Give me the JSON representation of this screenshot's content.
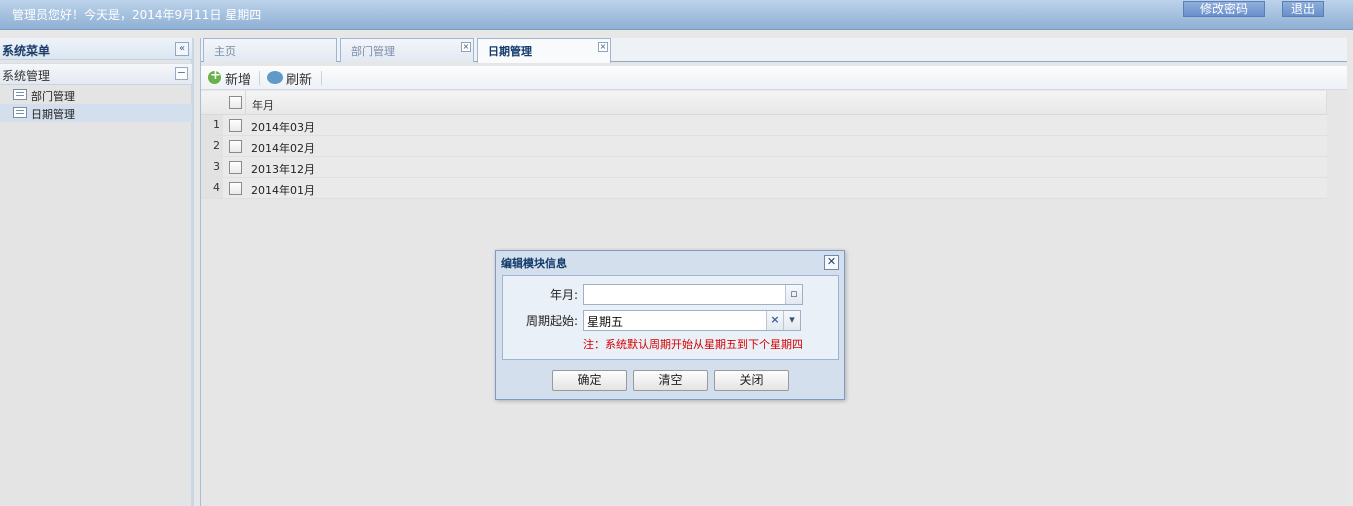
{
  "header": {
    "greeting": "管理员您好！今天是，2014年9月11日 星期四",
    "change_password_label": "修改密码",
    "logout_label": "退出"
  },
  "west": {
    "title": "系统菜单",
    "group_title": "系统管理",
    "items": [
      {
        "label": "部门管理"
      },
      {
        "label": "日期管理"
      }
    ]
  },
  "tabs": [
    {
      "label": "主页"
    },
    {
      "label": "部门管理"
    },
    {
      "label": "日期管理"
    }
  ],
  "toolbar": {
    "add_label": "新增",
    "refresh_label": "刷新"
  },
  "grid": {
    "column_header": "年月",
    "rows": [
      {
        "num": "1",
        "value": "2014年03月"
      },
      {
        "num": "2",
        "value": "2014年02月"
      },
      {
        "num": "3",
        "value": "2013年12月"
      },
      {
        "num": "4",
        "value": "2014年01月"
      }
    ]
  },
  "dialog": {
    "title": "编辑模块信息",
    "year_month_label": "年月:",
    "year_month_value": "",
    "week_start_label": "周期起始:",
    "week_start_value": "星期五",
    "note": "注：系统默认周期开始从星期五到下个星期四",
    "confirm_label": "确定",
    "clear_label": "清空",
    "close_label": "关闭"
  }
}
